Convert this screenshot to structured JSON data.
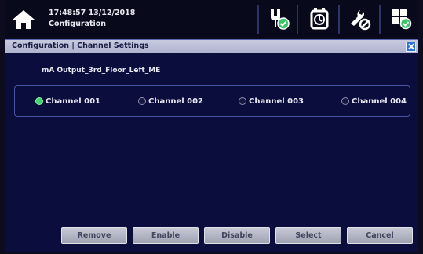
{
  "header": {
    "time_date": "17:48:57 13/12/2018",
    "screen": "Configuration",
    "icons": [
      "home-icon",
      "sensor-ok-icon",
      "alarm-clock-icon",
      "tools-icon",
      "grid-check-icon"
    ]
  },
  "dialog": {
    "title": "Configuration | Channel Settings",
    "output_name": "mA Output_3rd_Floor_Left_ME",
    "channels": [
      {
        "label": "Channel 001",
        "selected": true
      },
      {
        "label": "Channel 002",
        "selected": false
      },
      {
        "label": "Channel 003",
        "selected": false
      },
      {
        "label": "Channel 004",
        "selected": false
      }
    ],
    "buttons": {
      "remove": "Remove",
      "enable": "Enable",
      "disable": "Disable",
      "select": "Select",
      "cancel": "Cancel"
    }
  },
  "colors": {
    "background": "#0b0d3c",
    "header_bar": "#c8cbe0",
    "accent_close": "#2f6fd8",
    "selected_radio": "#3fd56a",
    "status_ok": "#3cc46a"
  }
}
